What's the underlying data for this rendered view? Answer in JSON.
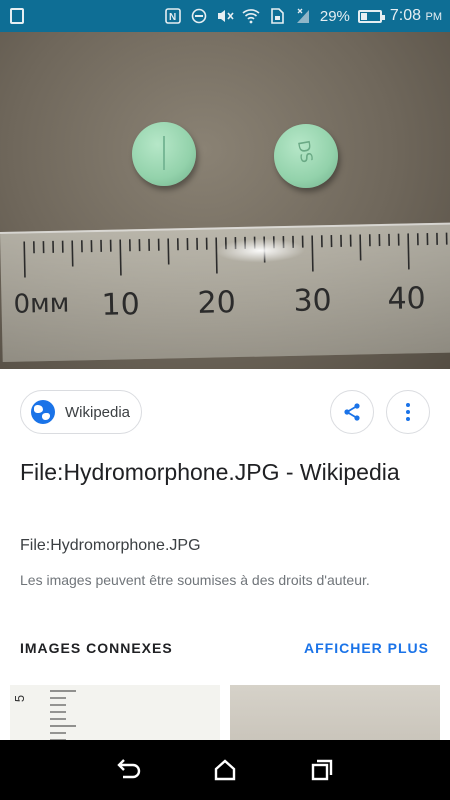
{
  "status_bar": {
    "battery": "29%",
    "battery_level": 0.29,
    "time": "7:08",
    "ampm": "PM",
    "icons": [
      "screen-icon",
      "nfc-icon",
      "dnd-icon",
      "mute-icon",
      "wifi-icon",
      "sim-icon",
      "signal-icon",
      "battery-icon"
    ]
  },
  "photo": {
    "pill_mark": "DS",
    "ruler_labels": [
      "0мм",
      "10",
      "20",
      "30",
      "40"
    ]
  },
  "result": {
    "source_label": "Wikipedia",
    "title": "File:Hydromorphone.JPG - Wikipedia",
    "subtitle": "File:Hydromorphone.JPG",
    "copyright_notice": "Les images peuvent être soumises à des droits d'auteur."
  },
  "related": {
    "header": "IMAGES CONNEXES",
    "see_more": "AFFICHER PLUS",
    "thumb1_label": "5"
  },
  "colors": {
    "status_bar": "#0e6e95",
    "accent": "#1a73e8",
    "nav_bar": "#000000"
  }
}
